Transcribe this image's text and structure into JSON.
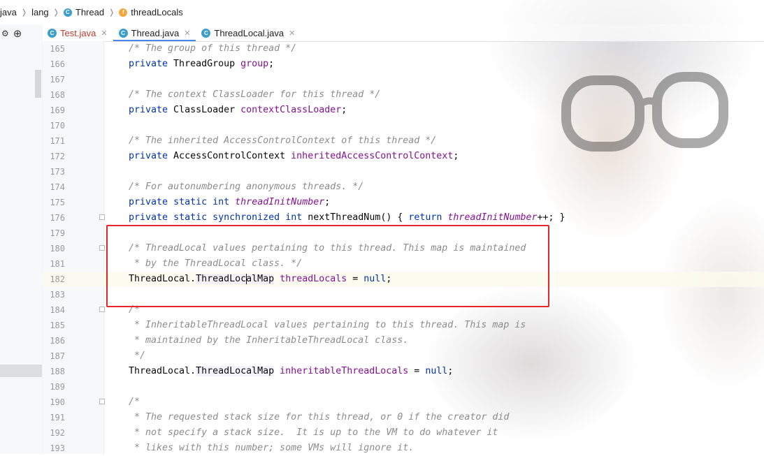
{
  "breadcrumb": [
    {
      "label": "java",
      "icon": "",
      "icon_name": "package-icon"
    },
    {
      "label": "lang",
      "icon": "",
      "icon_name": "package-icon"
    },
    {
      "label": "Thread",
      "icon": "C",
      "icon_name": "class-icon"
    },
    {
      "label": "threadLocals",
      "icon": "f",
      "icon_name": "field-icon"
    }
  ],
  "tabs": [
    {
      "label": "Test.java",
      "icon": "C",
      "active": false,
      "error": true
    },
    {
      "label": "Thread.java",
      "icon": "C",
      "active": true,
      "error": false
    },
    {
      "label": "ThreadLocal.java",
      "icon": "C",
      "active": false,
      "error": false
    }
  ],
  "sidebar": {
    "tools": [
      "⚙",
      "⊕"
    ]
  },
  "colors": {
    "highlight_box": "#e8262a",
    "keyword": "#0033b3",
    "field": "#871094",
    "comment": "#8c8c8c"
  },
  "editor": {
    "current_line": 182,
    "lines": [
      {
        "n": "165",
        "text": "/* The group of this thread */"
      },
      {
        "n": "166",
        "text": "private ThreadGroup group;"
      },
      {
        "n": "167",
        "text": ""
      },
      {
        "n": "168",
        "text": "/* The context ClassLoader for this thread */"
      },
      {
        "n": "169",
        "text": "private ClassLoader contextClassLoader;"
      },
      {
        "n": "170",
        "text": ""
      },
      {
        "n": "171",
        "text": "/* The inherited AccessControlContext of this thread */"
      },
      {
        "n": "172",
        "text": "private AccessControlContext inheritedAccessControlContext;"
      },
      {
        "n": "173",
        "text": ""
      },
      {
        "n": "174",
        "text": "/* For autonumbering anonymous threads. */"
      },
      {
        "n": "175",
        "text": "private static int threadInitNumber;"
      },
      {
        "n": "176",
        "text": "private static synchronized int nextThreadNum() { return threadInitNumber++; }"
      },
      {
        "n": "179",
        "text": ""
      },
      {
        "n": "180",
        "text": "/* ThreadLocal values pertaining to this thread. This map is maintained"
      },
      {
        "n": "181",
        "text": " * by the ThreadLocal class. */"
      },
      {
        "n": "182",
        "text": "ThreadLocal.ThreadLocalMap threadLocals = null;"
      },
      {
        "n": "183",
        "text": ""
      },
      {
        "n": "184",
        "text": "/*"
      },
      {
        "n": "185",
        "text": " * InheritableThreadLocal values pertaining to this thread. This map is"
      },
      {
        "n": "186",
        "text": " * maintained by the InheritableThreadLocal class."
      },
      {
        "n": "187",
        "text": " */"
      },
      {
        "n": "188",
        "text": "ThreadLocal.ThreadLocalMap inheritableThreadLocals = null;"
      },
      {
        "n": "189",
        "text": ""
      },
      {
        "n": "190",
        "text": "/*"
      },
      {
        "n": "191",
        "text": " * The requested stack size for this thread, or 0 if the creator did"
      },
      {
        "n": "192",
        "text": " * not specify a stack size.  It is up to the VM to do whatever it"
      },
      {
        "n": "193",
        "text": " * likes with this number; some VMs will ignore it."
      }
    ]
  }
}
